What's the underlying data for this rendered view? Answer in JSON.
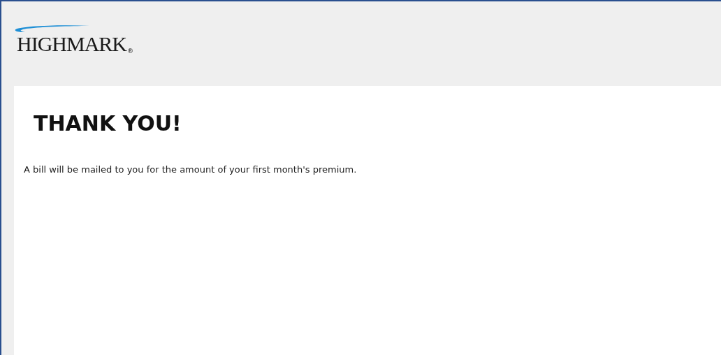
{
  "logo": {
    "text": "HIGHMARK",
    "mark": "®"
  },
  "heading": "THANK YOU!",
  "message": "A bill will be mailed to you for the amount of your first month's premium."
}
